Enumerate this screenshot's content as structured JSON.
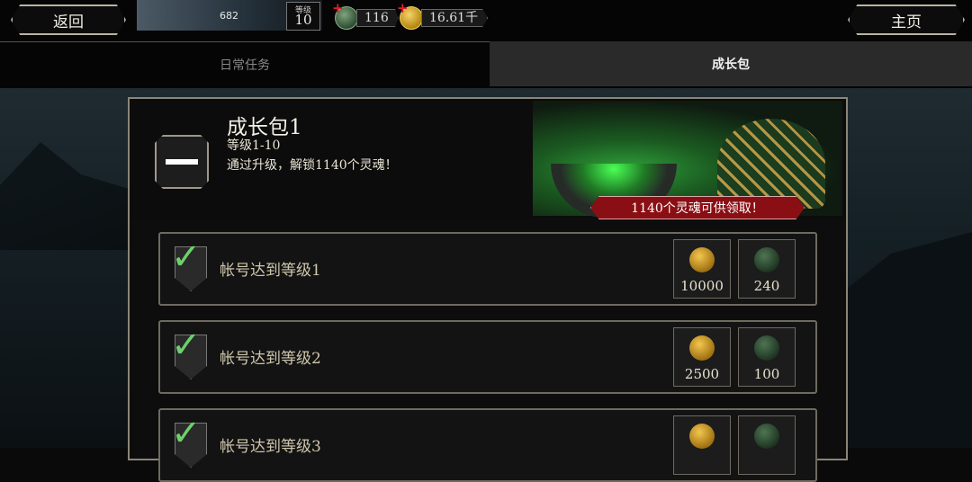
{
  "topbar": {
    "back_label": "返回",
    "home_label": "主页",
    "profile": {
      "xp": "682",
      "level_label": "等级",
      "level": "10"
    },
    "souls": "116",
    "coins": "16.61千"
  },
  "tabs": [
    {
      "label": "日常任务",
      "active": false
    },
    {
      "label": "成长包",
      "active": true
    }
  ],
  "pack": {
    "title": "成长包1",
    "level_range": "等级1-10",
    "description": "通过升级，解锁1140个灵魂！",
    "banner": "1140个灵魂可供领取！"
  },
  "rows": [
    {
      "label": "帐号达到等级1",
      "gold": "10000",
      "souls": "240"
    },
    {
      "label": "帐号达到等级2",
      "gold": "2500",
      "souls": "100"
    },
    {
      "label": "帐号达到等级3",
      "gold": "",
      "souls": ""
    }
  ],
  "colors": {
    "accent_green": "#6ed16b",
    "banner_red": "#8a0f14",
    "gold": "#f5d46a"
  }
}
